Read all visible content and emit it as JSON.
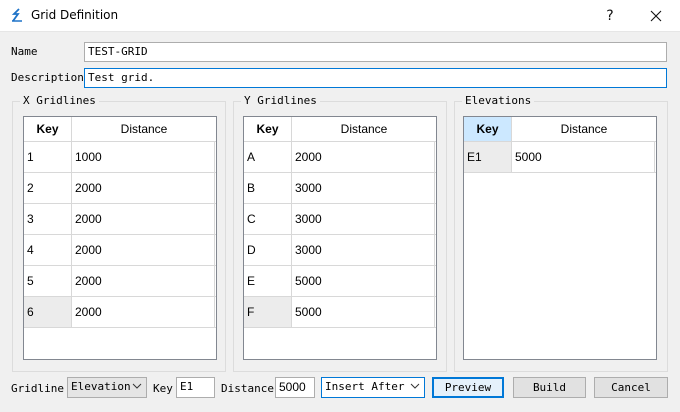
{
  "window": {
    "title": "Grid Definition",
    "help_label": "?",
    "close_label": "✕",
    "icon": "app-icon"
  },
  "form": {
    "name_label": "Name",
    "name_value": "TEST-GRID",
    "description_label": "Description",
    "description_value": "Test grid."
  },
  "x_gridlines": {
    "title": "X Gridlines",
    "headers": {
      "key": "Key",
      "distance": "Distance"
    },
    "rows": [
      {
        "key": "1",
        "distance": "1000"
      },
      {
        "key": "2",
        "distance": "2000"
      },
      {
        "key": "3",
        "distance": "2000"
      },
      {
        "key": "4",
        "distance": "2000"
      },
      {
        "key": "5",
        "distance": "2000"
      },
      {
        "key": "6",
        "distance": "2000"
      }
    ]
  },
  "y_gridlines": {
    "title": "Y Gridlines",
    "headers": {
      "key": "Key",
      "distance": "Distance"
    },
    "rows": [
      {
        "key": "A",
        "distance": "2000"
      },
      {
        "key": "B",
        "distance": "3000"
      },
      {
        "key": "C",
        "distance": "3000"
      },
      {
        "key": "D",
        "distance": "3000"
      },
      {
        "key": "E",
        "distance": "5000"
      },
      {
        "key": "F",
        "distance": "5000"
      }
    ]
  },
  "elevations": {
    "title": "Elevations",
    "headers": {
      "key": "Key",
      "distance": "Distance"
    },
    "rows": [
      {
        "key": "E1",
        "distance": "5000"
      }
    ]
  },
  "bottom": {
    "gridline_label": "Gridline",
    "gridline_value": "Elevation",
    "key_label": "Key",
    "key_value": "E1",
    "distance_label": "Distance",
    "distance_value": "5000",
    "insert_mode": "Insert After",
    "preview_label": "Preview",
    "build_label": "Build",
    "cancel_label": "Cancel"
  },
  "colors": {
    "accent": "#0078d7",
    "selected_header": "#cce8ff",
    "icon_blue": "#1e73c8"
  }
}
